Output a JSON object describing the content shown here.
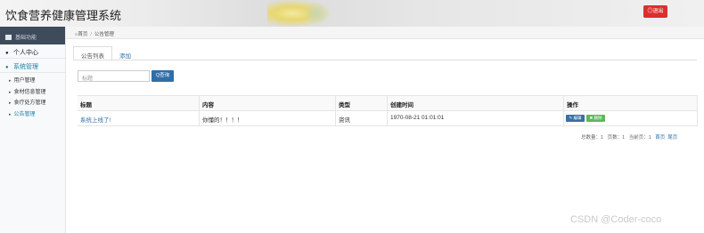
{
  "header": {
    "title": "饮食营养健康管理系统",
    "logout_label": "◎退出",
    "accent": "#d9302e"
  },
  "sidebar": {
    "head_label": "基础功能",
    "menu": [
      {
        "label": "个人中心",
        "icon": "user-icon"
      },
      {
        "label": "系统管理",
        "icon": "users-icon"
      }
    ],
    "sub_items": [
      {
        "label": "用户管理"
      },
      {
        "label": "食材信息管理"
      },
      {
        "label": "食疗处方管理"
      },
      {
        "label": "公告管理"
      }
    ]
  },
  "breadcrumb": {
    "home": "首页",
    "current": "公告管理"
  },
  "tabs": [
    {
      "label": "公告列表"
    },
    {
      "label": "添加"
    }
  ],
  "search": {
    "placeholder": "标题",
    "button_label": "Q查询"
  },
  "table": {
    "columns": [
      "标题",
      "内容",
      "类型",
      "创建时间",
      "操作"
    ],
    "rows": [
      {
        "title": "系统上线了!",
        "content": "你懂的！！！！",
        "type": "资讯",
        "created": "1970-08-21 01:01:01",
        "edit_label": "✎ 编辑",
        "delete_label": "✖ 删除"
      }
    ]
  },
  "pagination": {
    "total": "总数量：1",
    "pages": "页数：1",
    "current": "当前页：1",
    "first": "首页",
    "last": "尾页"
  },
  "watermark": "CSDN @Coder-coco"
}
